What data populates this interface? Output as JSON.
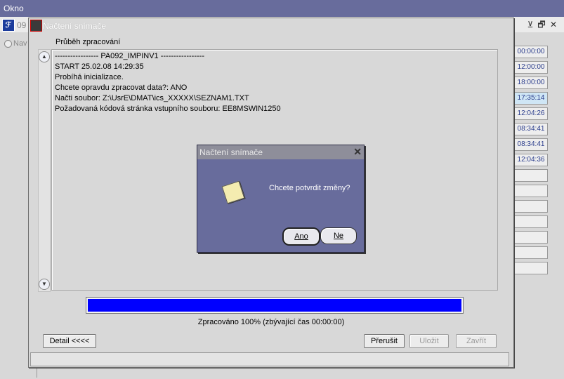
{
  "menubar": {
    "label": "Okno"
  },
  "background_window": {
    "title_fragment": "09",
    "radio_label": "Nav",
    "times": [
      "00:00:00",
      "12:00:00",
      "18:00:00",
      "17:35:14",
      "12:04:26",
      "08:34:41",
      "08:34:41",
      "12:04:36",
      "",
      "",
      "",
      "",
      "",
      "",
      ""
    ],
    "highlighted_time_index": 3
  },
  "dialog": {
    "title": "Načtení snímače",
    "section_label": "Průběh zpracování",
    "log_lines": [
      "----------------- PA092_IMPINV1 -----------------",
      "START 25.02.08 14:29:35",
      "Probíhá inicializace.",
      "Chcete opravdu zpracovat data?: ANO",
      "Načti soubor: Z:\\UsrE\\DMAT\\ics_XXXXX\\SEZNAM1.TXT",
      "Požadovaná kódová stránka vstupního souboru: EE8MSWIN1250"
    ],
    "progress_percent": 100,
    "progress_text": "Zpracováno 100% (zbývající čas 00:00:00)",
    "buttons": {
      "detail": "Detail  <<<<",
      "interrupt": "Přerušit",
      "save": "Uložit",
      "close": "Zavřít"
    }
  },
  "modal": {
    "title": "Načtení snímače",
    "message": "Chcete potvrdit změny?",
    "yes_label": "Ano",
    "no_label": "Ne"
  },
  "icons": {
    "forms_icon": "forms-app-icon",
    "note_icon": "note-icon"
  }
}
